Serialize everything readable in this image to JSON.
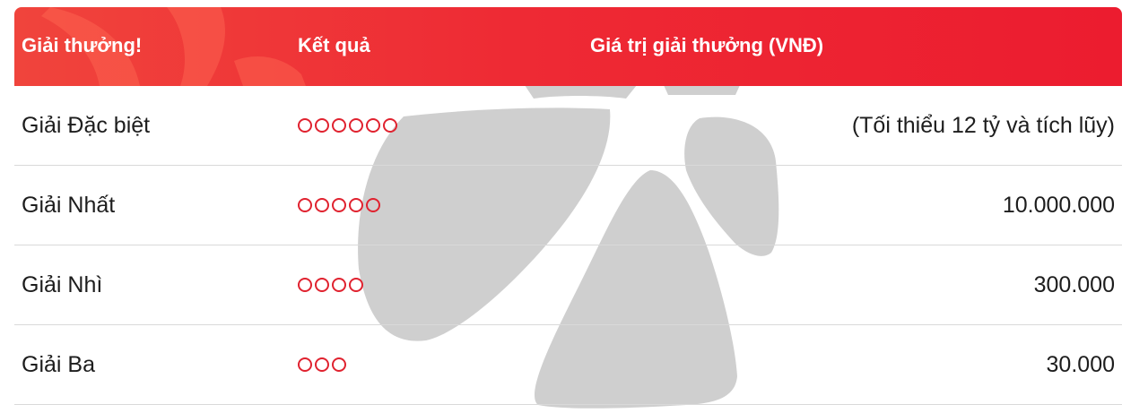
{
  "header": {
    "prize_label": "Giải thưởng!",
    "result_label": "Kết quả",
    "value_label": "Giá trị giải thưởng (VNĐ)"
  },
  "rows": [
    {
      "prize": "Giải Đặc biệt",
      "circles": 6,
      "value": "(Tối thiểu 12 tỷ và tích lũy)"
    },
    {
      "prize": "Giải Nhất",
      "circles": 5,
      "value": "10.000.000"
    },
    {
      "prize": "Giải Nhì",
      "circles": 4,
      "value": "300.000"
    },
    {
      "prize": "Giải Ba",
      "circles": 3,
      "value": "30.000"
    }
  ],
  "colors": {
    "header_red": "#ec1c2f",
    "circle_red": "#e0222f",
    "watermark_gray": "#cfcfcf"
  },
  "icons": {
    "watermark": "star-logo-watermark-icon"
  }
}
